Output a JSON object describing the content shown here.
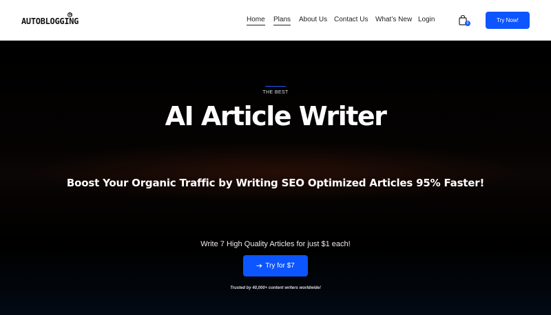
{
  "header": {
    "logo_text": "AUTOBLOGGING",
    "logo_mark": "TM",
    "nav": [
      {
        "label": "Home",
        "active": true
      },
      {
        "label": "Plans",
        "active": true
      },
      {
        "label": "About Us",
        "active": false
      },
      {
        "label": "Contact Us",
        "active": false
      },
      {
        "label": "What’s New",
        "active": false
      },
      {
        "label": "Login",
        "active": false
      }
    ],
    "cart_icon": "shopping-bag-icon",
    "cart_count": "0",
    "cta_label": "Try Now!"
  },
  "hero": {
    "eyebrow": "THE BEST",
    "headline": "AI Article Writer",
    "subhead": "Boost Your Organic Traffic by Writing SEO Optimized Articles 95% Faster!",
    "offer": "Write 7 High Quality Articles for just $1 each!",
    "cta_icon": "arrow-right-icon",
    "cta_label": "Try for $7",
    "trust": "Trusted by 40,000+ content writers worldwide!"
  },
  "colors": {
    "accent": "#0d55ff",
    "hero_bg": "#000000",
    "header_bg": "#ffffff"
  }
}
